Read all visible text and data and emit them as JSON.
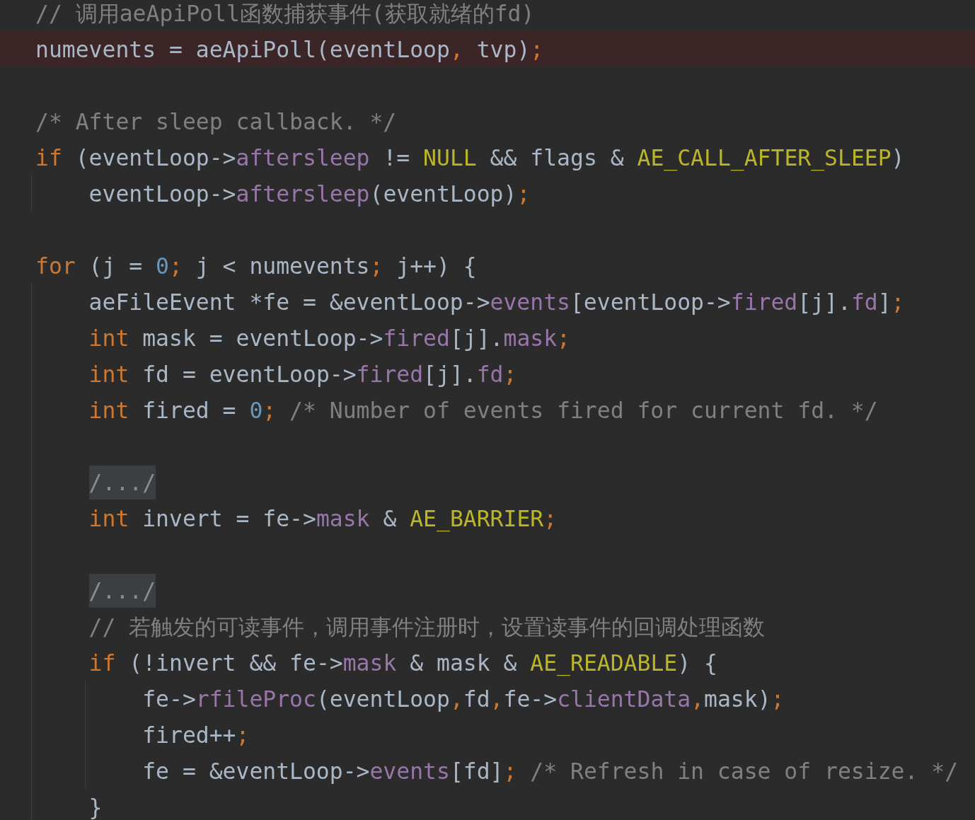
{
  "lines": [
    {
      "kind": "code",
      "highlighted": false,
      "tokens": [
        {
          "kind": "comment",
          "text": "// 调用aeApiPoll函数捕获事件(获取就绪的fd)"
        }
      ]
    },
    {
      "kind": "code",
      "highlighted": true,
      "tokens": [
        {
          "kind": "plain",
          "text": "numevents = aeApiPoll(eventLoop"
        },
        {
          "kind": "punct",
          "text": ","
        },
        {
          "kind": "plain",
          "text": " tvp)"
        },
        {
          "kind": "punct",
          "text": ";"
        }
      ]
    },
    {
      "kind": "blank"
    },
    {
      "kind": "code",
      "highlighted": false,
      "tokens": [
        {
          "kind": "comment",
          "text": "/* After sleep callback. */"
        }
      ]
    },
    {
      "kind": "code",
      "highlighted": false,
      "tokens": [
        {
          "kind": "keyword",
          "text": "if"
        },
        {
          "kind": "plain",
          "text": " (eventLoop->"
        },
        {
          "kind": "field",
          "text": "aftersleep"
        },
        {
          "kind": "plain",
          "text": " != "
        },
        {
          "kind": "constant",
          "text": "NULL"
        },
        {
          "kind": "plain",
          "text": " && flags & "
        },
        {
          "kind": "constant",
          "text": "AE_CALL_AFTER_SLEEP"
        },
        {
          "kind": "plain",
          "text": ")"
        }
      ],
      "children": [
        {
          "kind": "code",
          "tokens": [
            {
              "kind": "plain",
              "text": "eventLoop->"
            },
            {
              "kind": "field",
              "text": "aftersleep"
            },
            {
              "kind": "plain",
              "text": "(eventLoop)"
            },
            {
              "kind": "punct",
              "text": ";"
            }
          ]
        }
      ]
    },
    {
      "kind": "blank"
    },
    {
      "kind": "code",
      "highlighted": false,
      "tokens": [
        {
          "kind": "keyword",
          "text": "for"
        },
        {
          "kind": "plain",
          "text": " (j = "
        },
        {
          "kind": "number",
          "text": "0"
        },
        {
          "kind": "punct",
          "text": ";"
        },
        {
          "kind": "plain",
          "text": " j < numevents"
        },
        {
          "kind": "punct",
          "text": ";"
        },
        {
          "kind": "plain",
          "text": " j++) {"
        }
      ],
      "children": [
        {
          "kind": "code",
          "tokens": [
            {
              "kind": "plain",
              "text": "aeFileEvent *fe = &eventLoop->"
            },
            {
              "kind": "field",
              "text": "events"
            },
            {
              "kind": "plain",
              "text": "[eventLoop->"
            },
            {
              "kind": "field",
              "text": "fired"
            },
            {
              "kind": "plain",
              "text": "[j]."
            },
            {
              "kind": "field",
              "text": "fd"
            },
            {
              "kind": "plain",
              "text": "]"
            },
            {
              "kind": "punct",
              "text": ";"
            }
          ]
        },
        {
          "kind": "code",
          "tokens": [
            {
              "kind": "keyword",
              "text": "int"
            },
            {
              "kind": "plain",
              "text": " mask = eventLoop->"
            },
            {
              "kind": "field",
              "text": "fired"
            },
            {
              "kind": "plain",
              "text": "[j]."
            },
            {
              "kind": "field",
              "text": "mask"
            },
            {
              "kind": "punct",
              "text": ";"
            }
          ]
        },
        {
          "kind": "code",
          "tokens": [
            {
              "kind": "keyword",
              "text": "int"
            },
            {
              "kind": "plain",
              "text": " fd = eventLoop->"
            },
            {
              "kind": "field",
              "text": "fired"
            },
            {
              "kind": "plain",
              "text": "[j]."
            },
            {
              "kind": "field",
              "text": "fd"
            },
            {
              "kind": "punct",
              "text": ";"
            }
          ]
        },
        {
          "kind": "code",
          "tokens": [
            {
              "kind": "keyword",
              "text": "int"
            },
            {
              "kind": "plain",
              "text": " fired = "
            },
            {
              "kind": "number",
              "text": "0"
            },
            {
              "kind": "punct",
              "text": ";"
            },
            {
              "kind": "comment",
              "text": " /* Number of events fired for current fd. */"
            }
          ]
        },
        {
          "kind": "blank"
        },
        {
          "kind": "fold",
          "text": "/.../"
        },
        {
          "kind": "code",
          "tokens": [
            {
              "kind": "keyword",
              "text": "int"
            },
            {
              "kind": "plain",
              "text": " invert = fe->"
            },
            {
              "kind": "field",
              "text": "mask"
            },
            {
              "kind": "plain",
              "text": " & "
            },
            {
              "kind": "constant",
              "text": "AE_BARRIER"
            },
            {
              "kind": "punct",
              "text": ";"
            }
          ]
        },
        {
          "kind": "blank"
        },
        {
          "kind": "fold",
          "text": "/.../"
        },
        {
          "kind": "code",
          "tokens": [
            {
              "kind": "comment",
              "text": "// 若触发的可读事件，调用事件注册时，设置读事件的回调处理函数"
            }
          ]
        },
        {
          "kind": "code",
          "tokens": [
            {
              "kind": "keyword",
              "text": "if"
            },
            {
              "kind": "plain",
              "text": " (!invert && fe->"
            },
            {
              "kind": "field",
              "text": "mask"
            },
            {
              "kind": "plain",
              "text": " & mask & "
            },
            {
              "kind": "constant",
              "text": "AE_READABLE"
            },
            {
              "kind": "plain",
              "text": ") {"
            }
          ],
          "children": [
            {
              "kind": "code",
              "tokens": [
                {
                  "kind": "plain",
                  "text": "fe->"
                },
                {
                  "kind": "field",
                  "text": "rfileProc"
                },
                {
                  "kind": "plain",
                  "text": "(eventLoop"
                },
                {
                  "kind": "punct",
                  "text": ","
                },
                {
                  "kind": "plain",
                  "text": "fd"
                },
                {
                  "kind": "punct",
                  "text": ","
                },
                {
                  "kind": "plain",
                  "text": "fe->"
                },
                {
                  "kind": "field",
                  "text": "clientData"
                },
                {
                  "kind": "punct",
                  "text": ","
                },
                {
                  "kind": "plain",
                  "text": "mask)"
                },
                {
                  "kind": "punct",
                  "text": ";"
                }
              ]
            },
            {
              "kind": "code",
              "tokens": [
                {
                  "kind": "plain",
                  "text": "fired++"
                },
                {
                  "kind": "punct",
                  "text": ";"
                }
              ]
            },
            {
              "kind": "code",
              "tokens": [
                {
                  "kind": "plain",
                  "text": "fe = &eventLoop->"
                },
                {
                  "kind": "field",
                  "text": "events"
                },
                {
                  "kind": "plain",
                  "text": "[fd]"
                },
                {
                  "kind": "punct",
                  "text": ";"
                },
                {
                  "kind": "comment",
                  "text": " /* Refresh in case of resize. */"
                }
              ]
            }
          ]
        },
        {
          "kind": "code",
          "tokens": [
            {
              "kind": "plain",
              "text": "}"
            }
          ]
        }
      ]
    }
  ]
}
